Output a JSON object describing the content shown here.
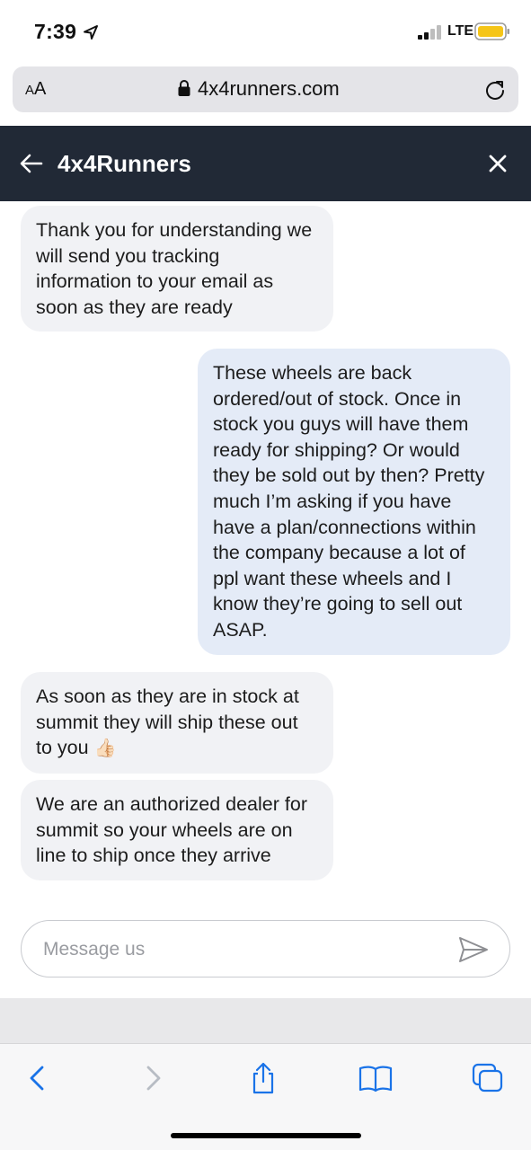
{
  "status_bar": {
    "time": "7:39",
    "network": "LTE",
    "battery_color": "#f5c518"
  },
  "browser": {
    "text_size_big": "A",
    "text_size_small": "A",
    "url": "4x4runners.com"
  },
  "chat": {
    "title": "4x4Runners",
    "header_color": "#212936",
    "messages": [
      {
        "sender": "agent",
        "text": "Thank you for understanding we will send you tracking information to your email as soon as they are ready"
      },
      {
        "sender": "user",
        "text": "These wheels are back ordered/out of stock. Once in stock you guys will have them ready for shipping? Or would they be sold out by then? Pretty much I’m asking if you have have a plan/connections within the company because a lot of ppl want these wheels and I know they’re going to sell out ASAP."
      },
      {
        "sender": "agent",
        "text": "As soon as they are in stock at summit they will ship these out to you",
        "emoji": "👍🏻"
      },
      {
        "sender": "agent",
        "text": "We are an authorized dealer for summit so your wheels are on line to ship once they arrive"
      }
    ],
    "composer": {
      "placeholder": "Message us",
      "value": ""
    }
  },
  "toolbar": {
    "items": [
      "back-icon",
      "forward-icon",
      "share-icon",
      "bookmarks-icon",
      "tabs-icon"
    ],
    "accent": "#1a73e8"
  }
}
